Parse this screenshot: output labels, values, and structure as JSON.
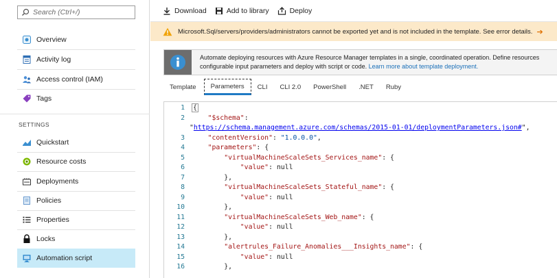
{
  "sidebar": {
    "search_placeholder": "Search (Ctrl+/)",
    "items": [
      {
        "label": "Overview",
        "icon": "overview-icon"
      },
      {
        "label": "Activity log",
        "icon": "activity-log-icon"
      },
      {
        "label": "Access control (IAM)",
        "icon": "iam-icon"
      },
      {
        "label": "Tags",
        "icon": "tag-icon"
      }
    ],
    "section_title": "SETTINGS",
    "settings_items": [
      {
        "label": "Quickstart",
        "icon": "quickstart-icon"
      },
      {
        "label": "Resource costs",
        "icon": "resource-costs-icon"
      },
      {
        "label": "Deployments",
        "icon": "deployments-icon"
      },
      {
        "label": "Policies",
        "icon": "policies-icon"
      },
      {
        "label": "Properties",
        "icon": "properties-icon"
      },
      {
        "label": "Locks",
        "icon": "lock-icon"
      },
      {
        "label": "Automation script",
        "icon": "automation-script-icon",
        "selected": true
      }
    ]
  },
  "toolbar": {
    "download_label": "Download",
    "add_library_label": "Add to library",
    "deploy_label": "Deploy"
  },
  "warning": {
    "text": "Microsoft.Sql/servers/providers/administrators cannot be exported yet and is not included in the template. See error details.",
    "arrow": "➔"
  },
  "info": {
    "line1": "Automate deploying resources with Azure Resource Manager templates in a single, coordinated operation. Define resources",
    "line2": "configurable input parameters and deploy with script or code.",
    "link": "Learn more about template deployment."
  },
  "tabs": [
    "Template",
    "Parameters",
    "CLI",
    "CLI 2.0",
    "PowerShell",
    ".NET",
    "Ruby"
  ],
  "active_tab": "Parameters",
  "editor": {
    "lines": [
      {
        "n": "1",
        "t": "{"
      },
      {
        "n": "2",
        "t": "    \"$schema\":"
      },
      {
        "n": "",
        "t": "\"https://schema.management.azure.com/schemas/2015-01-01/deploymentParameters.json#\","
      },
      {
        "n": "3",
        "t": "    \"contentVersion\": \"1.0.0.0\","
      },
      {
        "n": "4",
        "t": "    \"parameters\": {"
      },
      {
        "n": "5",
        "t": "        \"virtualMachineScaleSets_Services_name\": {"
      },
      {
        "n": "6",
        "t": "            \"value\": null"
      },
      {
        "n": "7",
        "t": "        },"
      },
      {
        "n": "8",
        "t": "        \"virtualMachineScaleSets_Stateful_name\": {"
      },
      {
        "n": "9",
        "t": "            \"value\": null"
      },
      {
        "n": "10",
        "t": "        },"
      },
      {
        "n": "11",
        "t": "        \"virtualMachineScaleSets_Web_name\": {"
      },
      {
        "n": "12",
        "t": "            \"value\": null"
      },
      {
        "n": "13",
        "t": "        },"
      },
      {
        "n": "14",
        "t": "        \"alertrules_Failure_Anomalies___Insights_name\": {"
      },
      {
        "n": "15",
        "t": "            \"value\": null"
      },
      {
        "n": "16",
        "t": "        },"
      }
    ]
  },
  "colors": {
    "selected_bg": "#c7eaf8",
    "warning_bg": "#fce9c9",
    "warning_icon": "#f0a30a",
    "link": "#1a6fb8",
    "tab_underline": "#1f7ac4"
  }
}
